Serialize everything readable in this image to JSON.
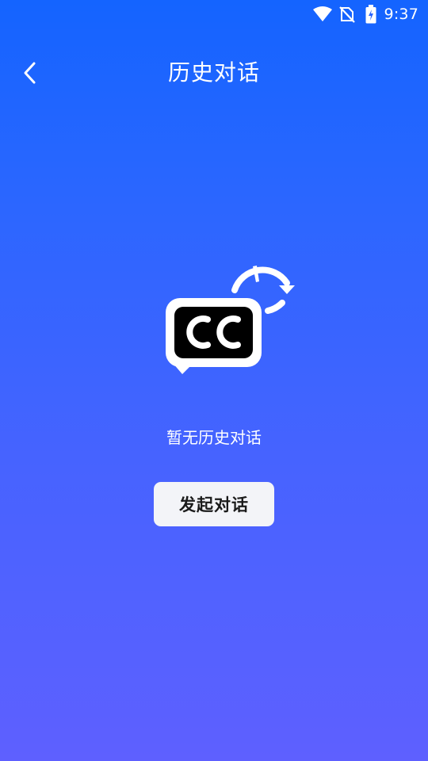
{
  "status_bar": {
    "time": "9:37",
    "icons": [
      "wifi-icon",
      "no-sim-icon",
      "battery-charging-icon"
    ]
  },
  "header": {
    "back_icon": "chevron-left-icon",
    "title": "历史对话"
  },
  "empty_state": {
    "illustration": "chat-history-icon",
    "message": "暂无历史对话"
  },
  "actions": {
    "start_label": "发起对话"
  },
  "colors": {
    "background_top": "#1464ff",
    "background_bottom": "#5e60ff",
    "button_background": "#f3f4f8",
    "button_text": "#1a1a1a",
    "icon_dark": "#000000"
  }
}
